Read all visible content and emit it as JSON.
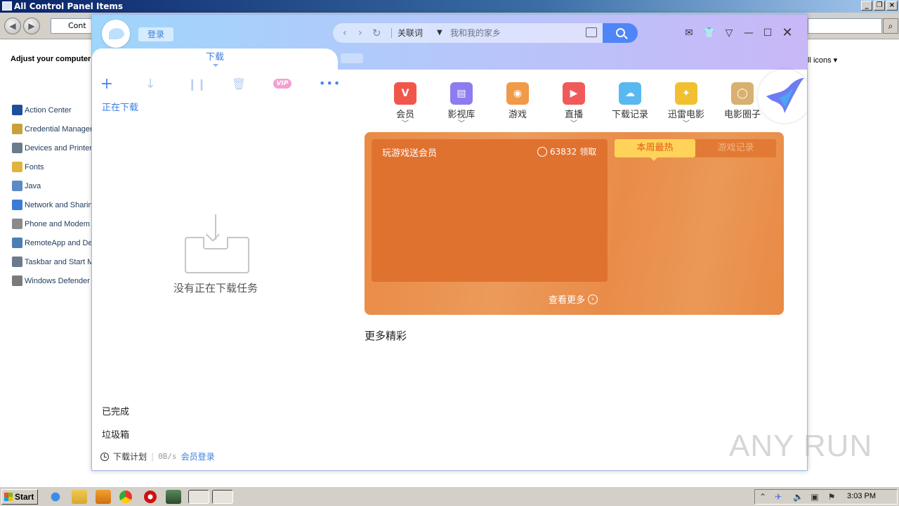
{
  "control_panel": {
    "title": "All Control Panel Items",
    "address_text": "Cont",
    "adjust_text": "Adjust your computer",
    "viewby_text": "ll icons",
    "items": [
      {
        "label": "Action Center",
        "color": "#1d4f9c"
      },
      {
        "label": "Credential Manager",
        "color": "#c9a13a"
      },
      {
        "label": "Devices and Printers",
        "color": "#6b7b8c"
      },
      {
        "label": "Fonts",
        "color": "#e0b33c"
      },
      {
        "label": "Java",
        "color": "#5b8ac6"
      },
      {
        "label": "Network and Sharing",
        "color": "#3a7bd5"
      },
      {
        "label": "Phone and Modem",
        "color": "#8a8a8a"
      },
      {
        "label": "RemoteApp and Des",
        "color": "#4a7fb5"
      },
      {
        "label": "Taskbar and Start M",
        "color": "#6b7b8c"
      },
      {
        "label": "Windows Defender",
        "color": "#7a7a7a"
      }
    ]
  },
  "xunlei": {
    "login_label": "登录",
    "search": {
      "keyword_label": "关联词",
      "placeholder": "我和我的家乡"
    },
    "download_tab": "下载",
    "downloading_label": "正在下载",
    "empty_message": "没有正在下载任务",
    "vip_label": "VIP",
    "completed_label": "已完成",
    "trash_label": "垃圾箱",
    "footer": {
      "plan_label": "下载计划",
      "speed": "0B/s",
      "member_login": "会员登录"
    },
    "nav_items": [
      {
        "label": "会员",
        "glyph": "V",
        "color": "#f0574a",
        "has_chevron": true
      },
      {
        "label": "影视库",
        "glyph": "▤",
        "color": "#8c7cf0",
        "has_chevron": true
      },
      {
        "label": "游戏",
        "glyph": "◉",
        "color": "#f09a4a",
        "has_chevron": false
      },
      {
        "label": "直播",
        "glyph": "▶",
        "color": "#f05a5a",
        "has_chevron": true
      },
      {
        "label": "下载记录",
        "glyph": "☁",
        "color": "#5ab8f0",
        "has_chevron": false
      },
      {
        "label": "迅雷电影",
        "glyph": "✦",
        "color": "#f0c030",
        "has_chevron": true
      },
      {
        "label": "电影圈子",
        "glyph": "◯",
        "color": "#d8b070",
        "has_chevron": false
      }
    ],
    "game_card": {
      "title": "玩游戏送会员",
      "count": "63832",
      "claim_label": "领取",
      "tabs": [
        "本周最热",
        "游戏记录"
      ],
      "more_label": "查看更多"
    },
    "more_section_title": "更多精彩"
  },
  "watermark": "ANY RUN",
  "taskbar": {
    "start_label": "Start",
    "clock": "3:03 PM"
  }
}
